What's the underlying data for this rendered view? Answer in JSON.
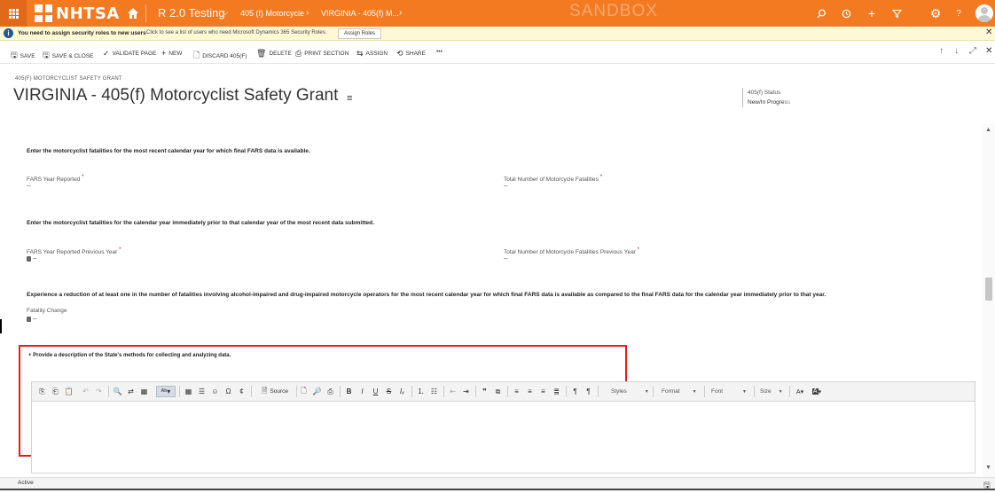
{
  "topbar": {
    "logo_text": "NHTSA",
    "app_name": "R 2.0 Testing",
    "breadcrumb_entity": "405 (f) Motorcycle",
    "breadcrumb_record": "VIRGINIA - 405(f) M...",
    "environment": "SANDBOX",
    "icons": [
      "waffle-icon",
      "home-icon",
      "search-icon",
      "history-icon",
      "add-icon",
      "filter-icon",
      "settings-icon",
      "help-icon",
      "user-avatar"
    ],
    "brand_color": "#f37a21"
  },
  "notification": {
    "title": "You need to assign security roles to new users",
    "description": "Click to see a list of users who need Microsoft Dynamics 365 Security Roles.",
    "button": "Assign Roles"
  },
  "commands": {
    "save": "SAVE",
    "save_close": "SAVE & CLOSE",
    "validate": "VALIDATE PAGE",
    "new": "NEW",
    "discard": "DISCARD 405(F)",
    "delete": "DELETE",
    "print": "PRINT SECTION",
    "assign": "ASSIGN",
    "share": "SHARE",
    "more": "•••"
  },
  "header": {
    "entity_label": "405(F) MOTORCYCLIST SAFETY GRANT",
    "title": "VIRGINIA - 405(f) Motorcyclist Safety Grant",
    "status_label": "405(f) Status",
    "status_value": "New/In Progress"
  },
  "form": {
    "section1_heading": "Enter the motorcyclist fatalities for the most recent calendar year for which final FARS data is available.",
    "fars_year_label": "FARS Year Reported",
    "fars_year_value": "--",
    "total_fatalities_label": "Total Number of Motorcycle Fatalities",
    "total_fatalities_value": "--",
    "section2_heading": "Enter the motorcyclist fatalities for the calendar year immediately prior to that calendar year of the most recent data submitted.",
    "fars_prev_label": "FARS Year Reported Previous Year",
    "fars_prev_value": "--",
    "total_prev_label": "Total Number of Motorcycle Fatalities Previous Year",
    "total_prev_value": "--",
    "section3_heading": "Experience a reduction of at least one in the number of fatalities involving alcohol-impaired and drug-impaired motorcycle operators for the most recent calendar year for which final FARS data is available as compared to the final FARS data for the calendar year immediately prior to that year.",
    "fatality_change_label": "Fatality Change",
    "fatality_change_value": "--",
    "required_mark": "*",
    "description_label": "+ Provide a description of the State's methods for collecting and analyzing data."
  },
  "editor": {
    "source": "Source",
    "styles": "Styles",
    "format": "Format",
    "font": "Font",
    "size": "Size"
  },
  "footer": {
    "status": "Active"
  }
}
